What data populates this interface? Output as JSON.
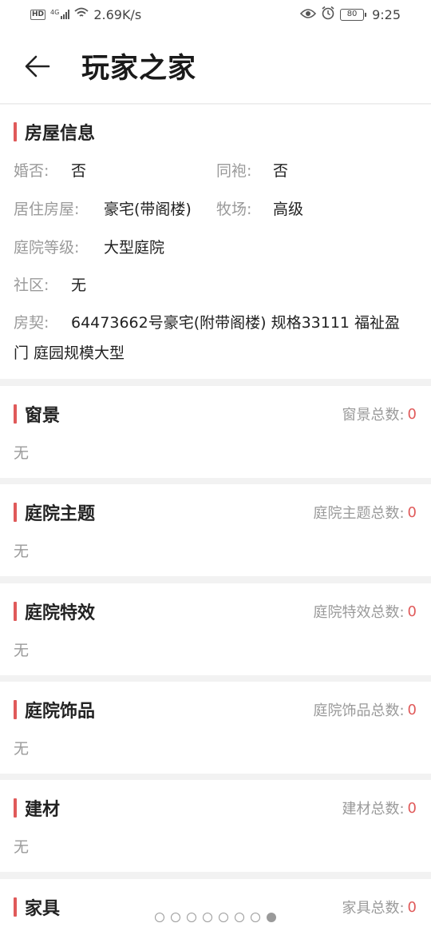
{
  "status_bar": {
    "hd": "HD",
    "net_type": "4G",
    "speed": "2.69K/s",
    "battery": "80",
    "time": "9:25"
  },
  "header": {
    "title": "玩家之家"
  },
  "house": {
    "title": "房屋信息",
    "married_label": "婚否:",
    "married_value": "否",
    "robe_label": "同袍:",
    "robe_value": "否",
    "residence_label": "居住房屋:",
    "residence_value": "豪宅(带阁楼)",
    "ranch_label": "牧场:",
    "ranch_value": "高级",
    "yard_label": "庭院等级:",
    "yard_value": "大型庭院",
    "community_label": "社区:",
    "community_value": "无",
    "deed_label": "房契:",
    "deed_value": "64473662号豪宅(附带阁楼) 规格33111 福祉盈门 庭园规模大型"
  },
  "sections": [
    {
      "title": "窗景",
      "count_label": "窗景总数:",
      "count": "0",
      "empty": "无"
    },
    {
      "title": "庭院主题",
      "count_label": "庭院主题总数:",
      "count": "0",
      "empty": "无"
    },
    {
      "title": "庭院特效",
      "count_label": "庭院特效总数:",
      "count": "0",
      "empty": "无"
    },
    {
      "title": "庭院饰品",
      "count_label": "庭院饰品总数:",
      "count": "0",
      "empty": "无"
    },
    {
      "title": "建材",
      "count_label": "建材总数:",
      "count": "0",
      "empty": "无"
    },
    {
      "title": "家具",
      "count_label": "家具总数:",
      "count": "0"
    }
  ],
  "pager": {
    "total": 8,
    "active_index": 7
  },
  "colors": {
    "accent": "#e05a5a",
    "muted": "#9a9a9a",
    "background": "#f2f2f2"
  }
}
